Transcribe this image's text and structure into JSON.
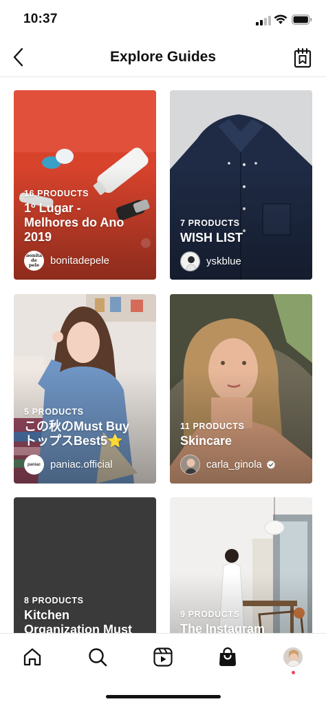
{
  "status_bar": {
    "time": "10:37"
  },
  "header": {
    "title": "Explore Guides",
    "back_icon": "chevron-left-icon",
    "action_icon": "guide-bookmark-icon"
  },
  "guides": [
    {
      "count": "16 PRODUCTS",
      "title_lines": [
        "1º Lugar -",
        "Melhores do Ano",
        "2019"
      ],
      "author": "bonitadepele",
      "avatar_text": "bonita de pele",
      "verified": false
    },
    {
      "count": "7 PRODUCTS",
      "title_lines": [
        "WISH LIST"
      ],
      "author": "yskblue",
      "verified": false
    },
    {
      "count": "5 PRODUCTS",
      "title_lines": [
        "この秋のMust Buy",
        "トップスBest5⭐"
      ],
      "author": "paniac.official",
      "avatar_text": "paniac",
      "verified": false
    },
    {
      "count": "11 PRODUCTS",
      "title_lines": [
        "Skincare"
      ],
      "author": "carla_ginola",
      "verified": true
    },
    {
      "count": "8 PRODUCTS",
      "title_lines": [
        "Kitchen",
        "Organization Must"
      ],
      "author": "",
      "verified": false
    },
    {
      "count": "9 PRODUCTS",
      "title_lines": [
        "The Instagram"
      ],
      "author": "",
      "verified": false
    }
  ],
  "bottom_nav": {
    "items": [
      "home-icon",
      "search-icon",
      "reels-icon",
      "shop-bag-icon",
      "profile-avatar"
    ],
    "notification_dot_color": "#ed4956"
  },
  "colors": {
    "card1_bg": "#d8432c",
    "card2_bg": "#2b3a55",
    "card5_bg": "#3a3a3a",
    "text": "#111111"
  }
}
